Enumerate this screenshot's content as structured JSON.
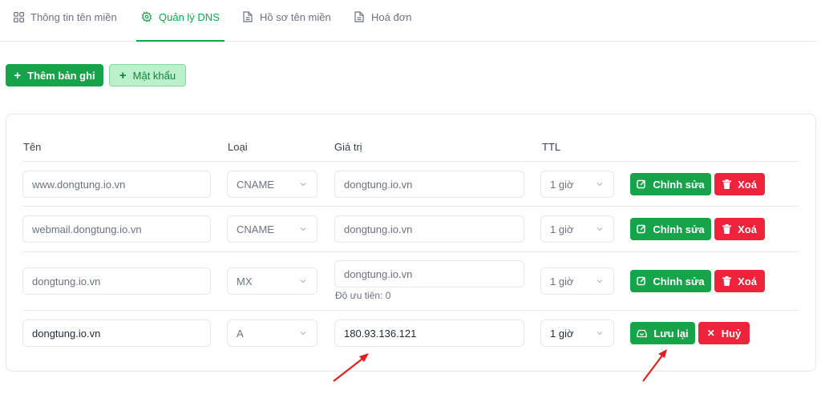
{
  "tabs": [
    {
      "label": "Thông tin tên miền",
      "icon": "grid-icon"
    },
    {
      "label": "Quản lý DNS",
      "icon": "gear-icon"
    },
    {
      "label": "Hồ sơ tên miền",
      "icon": "document-icon"
    },
    {
      "label": "Hoá đơn",
      "icon": "document-icon"
    }
  ],
  "toolbar": {
    "add_label": "Thêm bản ghi",
    "password_label": "Mật khẩu"
  },
  "table": {
    "headers": {
      "name": "Tên",
      "type": "Loại",
      "value": "Giá trị",
      "ttl": "TTL"
    },
    "rows": [
      {
        "name": "www.dongtung.io.vn",
        "type": "CNAME",
        "value": "dongtung.io.vn",
        "ttl": "1 giờ",
        "edit": "Chỉnh sửa",
        "delete": "Xoá"
      },
      {
        "name": "webmail.dongtung.io.vn",
        "type": "CNAME",
        "value": "dongtung.io.vn",
        "ttl": "1 giờ",
        "edit": "Chỉnh sửa",
        "delete": "Xoá"
      },
      {
        "name": "dongtung.io.vn",
        "type": "MX",
        "value": "dongtung.io.vn",
        "priority": "Độ ưu tiên: 0",
        "ttl": "1 giờ",
        "edit": "Chỉnh sửa",
        "delete": "Xoá"
      },
      {
        "name": "dongtung.io.vn",
        "type": "A",
        "value": "180.93.136.121",
        "ttl": "1 giờ",
        "save": "Lưu lại",
        "cancel": "Huỷ"
      }
    ]
  },
  "colors": {
    "accent": "#16a34a",
    "danger": "#ef233c",
    "arrow": "#e02020"
  }
}
